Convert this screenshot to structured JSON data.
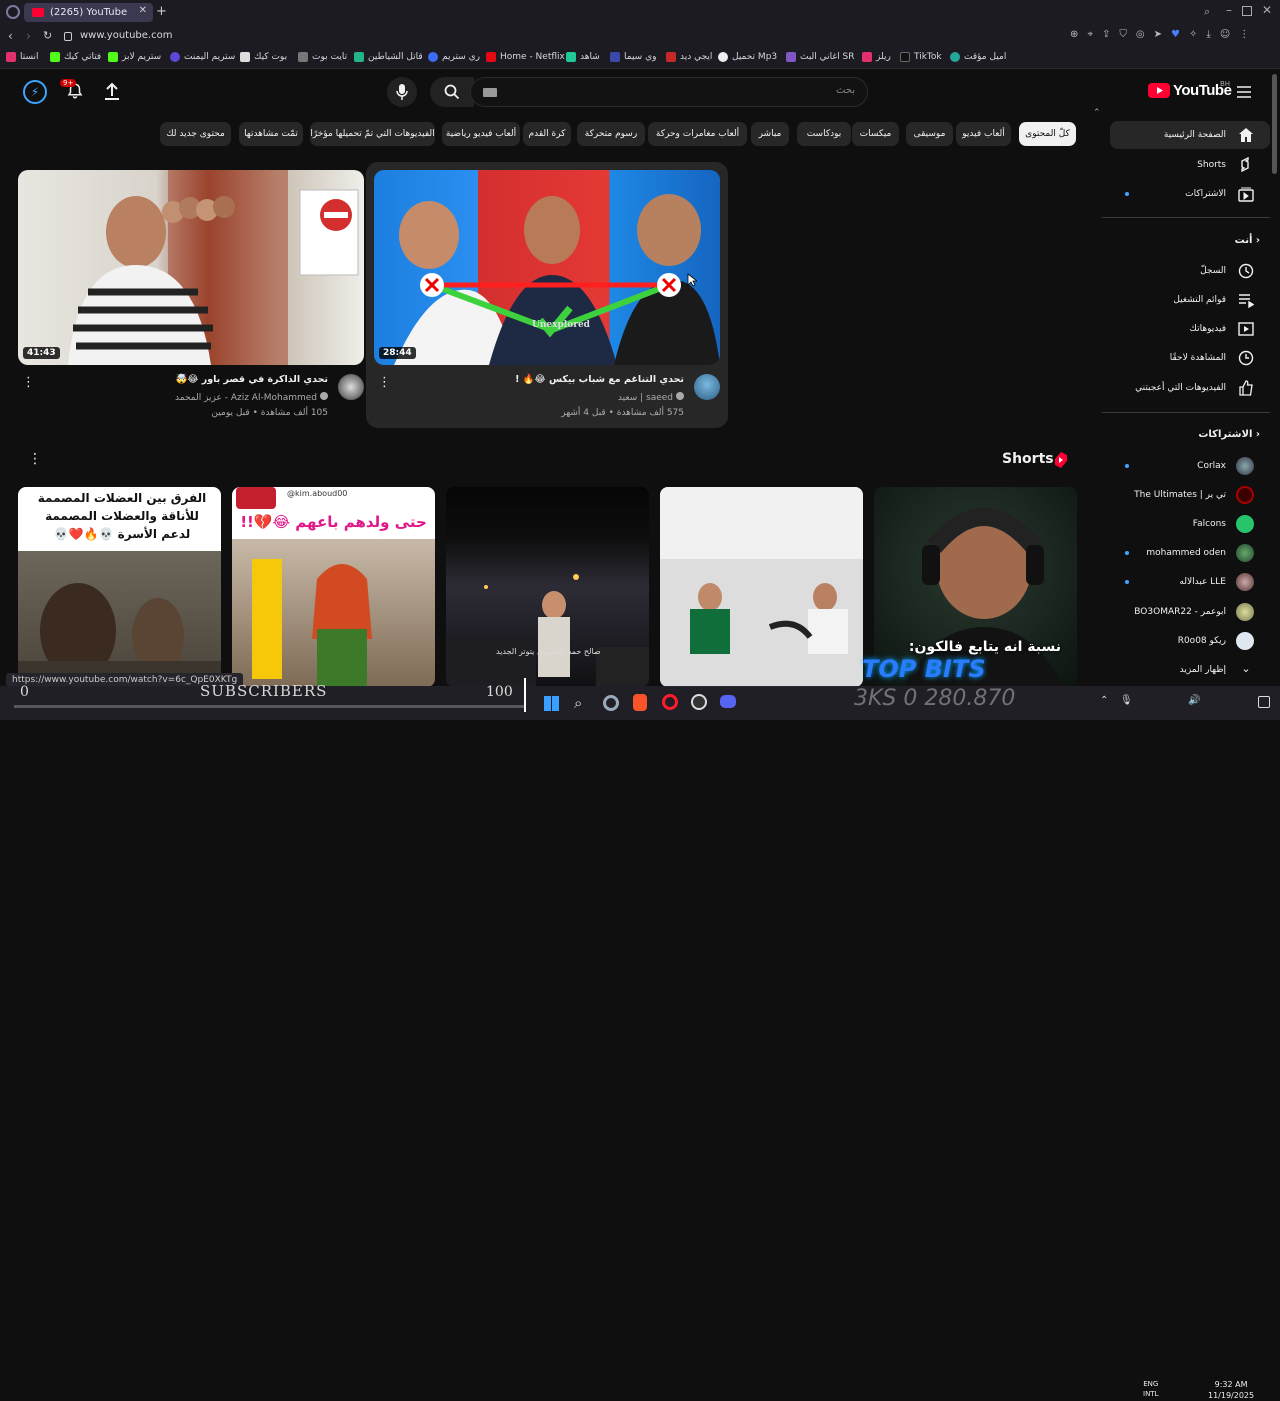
{
  "browser": {
    "tab_title": "(2265) YouTube",
    "url": "www.youtube.com",
    "bookmarks": [
      "انستا",
      "فتاتي كيك",
      "ستريم لابز",
      "ستريم اليمنت",
      "بوت كيك",
      "تايت بوت",
      "قاتل الشياطين",
      "ري ستريم",
      "Home - Netflix",
      "شاهد",
      "وي سيما",
      "ايجي ديد",
      "تحميل Mp3",
      "اغاني البث SR",
      "ريلز",
      "TikTok",
      "اميل مؤقت"
    ]
  },
  "header": {
    "search_placeholder": "بحث",
    "notification_count": "9+",
    "logo_text": "YouTube",
    "region": "BH"
  },
  "chips": [
    "كلّ المحتوى",
    "ألعاب فيديو",
    "موسيقى",
    "ميكسات",
    "بودكاست",
    "مباشر",
    "ألعاب مغامرات وحركة",
    "رسوم متحركة",
    "كرة القدم",
    "ألعاب فيديو رياضية",
    "الفيديوهات التي تمّ تحميلها مؤخرًا",
    "تمّت مشاهدتها",
    "محتوى جديد لك"
  ],
  "sidebar": {
    "main": [
      "الصفحة الرئيسية",
      "Shorts",
      "الاشتراكات"
    ],
    "you_heading": "أنت",
    "you": [
      "السجلّ",
      "قوائم التشغيل",
      "فيديوهاتك",
      "المشاهدة لاحقًا",
      "الفيديوهات التي أعجبتني"
    ],
    "subs_heading": "الاشتراكات",
    "subscriptions": [
      "Corlax",
      "The Ultimates | تي ير",
      "Falcons",
      "mohammed oden",
      "عبدالاله LLE",
      "BO3OMAR22 - ابوعمر",
      "R0o08 ريكو",
      "إظهار المزيد"
    ]
  },
  "videos": [
    {
      "title": "تحدي التناغم مع شباب بيكس 😂🔥 !",
      "channel": "saeed | سعيد",
      "meta": "575 ألف مشاهدة • قبل 4 أشهر",
      "duration": "28:44",
      "thumb_text": "Unexplored"
    },
    {
      "title": "تحدي الذاكرة في قصر باور 😂🤯",
      "channel": "Aziz Al-Mohammed - عزيز المحمد",
      "meta": "105 ألف مشاهدة • قبل يومين",
      "duration": "41:43",
      "thumb_text": "ممنوع الدخول"
    }
  ],
  "shorts": {
    "heading": "Shorts",
    "items": [
      {
        "caption": "الفرق بين العضلات المصممة للأناقة والعضلات المصممة لدعم الأسرة 💀🔥❤️💀"
      },
      {
        "caption": "حتى ولدهم باعهم 😂💔!!",
        "handle": "@kim.aboud00"
      },
      {
        "caption": "صالح حمد الحجيري يتوتر الجديد"
      },
      {
        "caption": ""
      },
      {
        "caption": "نسبة انه يتابع فالكون:"
      }
    ]
  },
  "overlay": {
    "status_url": "https://www.youtube.com/watch?v=6c_QpE0XKTg",
    "subscribers_label": "SUBSCRIBERS",
    "progress_start": "0",
    "progress_end": "100",
    "brand": "TOP BITS",
    "count": "3KS 0 280.870"
  },
  "taskbar": {
    "lang_1": "ENG",
    "lang_2": "INTL",
    "time": "9:32 AM",
    "date": "11/19/2025"
  },
  "colors": {
    "background": "#0f0f0f",
    "chip": "#272727",
    "accent_red": "#ff0033",
    "link_blue": "#3ea6ff"
  }
}
